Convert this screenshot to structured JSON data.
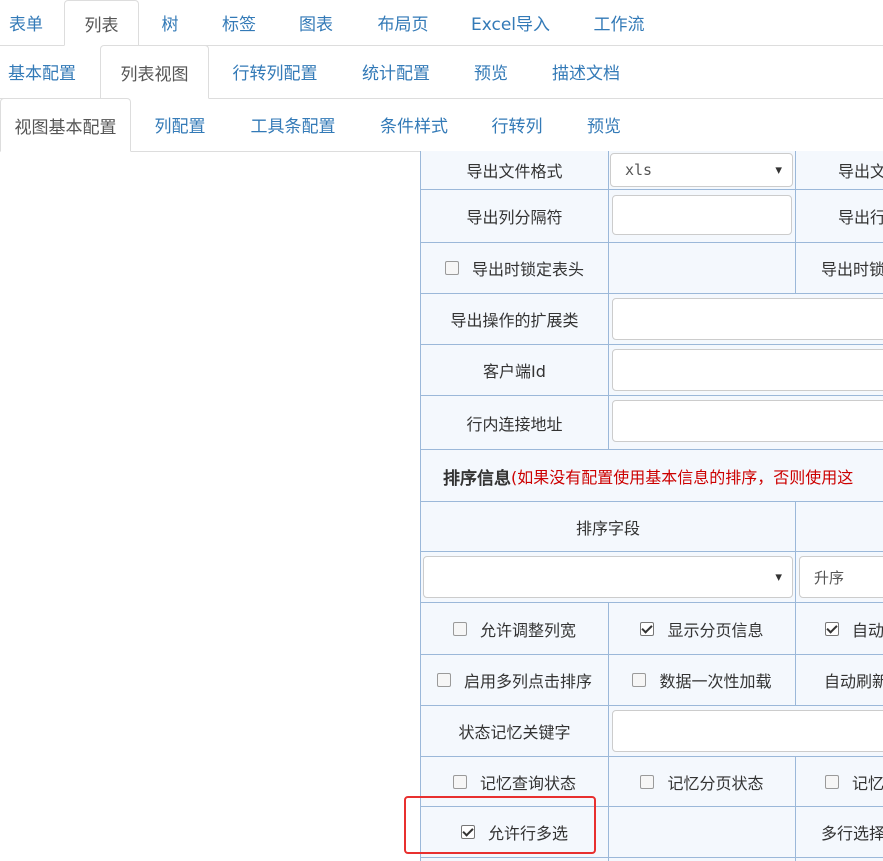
{
  "tabs_level1": [
    "表单",
    "列表",
    "树",
    "标签",
    "图表",
    "布局页",
    "Excel导入",
    "工作流"
  ],
  "tabs_level2": [
    "基本配置",
    "列表视图",
    "行转列配置",
    "统计配置",
    "预览",
    "描述文档"
  ],
  "tabs_level3": [
    "视图基本配置",
    "列配置",
    "工具条配置",
    "条件样式",
    "行转列",
    "预览"
  ],
  "form": {
    "export_format_label": "导出文件格式",
    "export_format_value": "xls",
    "export_format_right": "导出文",
    "export_sep_label": "导出列分隔符",
    "export_sep_right": "导出行",
    "lock_header_label": "导出时锁定表头",
    "lock_header_right": "导出时锁",
    "export_ext_label": "导出操作的扩展类",
    "client_id_label": "客户端Id",
    "inline_link_label": "行内连接地址",
    "sort_section_title": "排序信息",
    "sort_section_note": "(如果没有配置使用基本信息的排序，否则使用这",
    "sort_field_header": "排序字段",
    "sort_order_value": "升序",
    "allow_resize_label": "允许调整列宽",
    "show_paging_label": "显示分页信息",
    "auto_label": "自动",
    "multi_sort_label": "启用多列点击排序",
    "load_once_label": "数据一次性加载",
    "auto_refresh_label": "自动刷新",
    "state_key_label": "状态记忆关键字",
    "remember_query_label": "记忆查询状态",
    "remember_paging_label": "记忆分页状态",
    "remember_right_label": "记忆",
    "multi_select_label": "允许行多选",
    "multi_select_right_label": "多行选择"
  }
}
